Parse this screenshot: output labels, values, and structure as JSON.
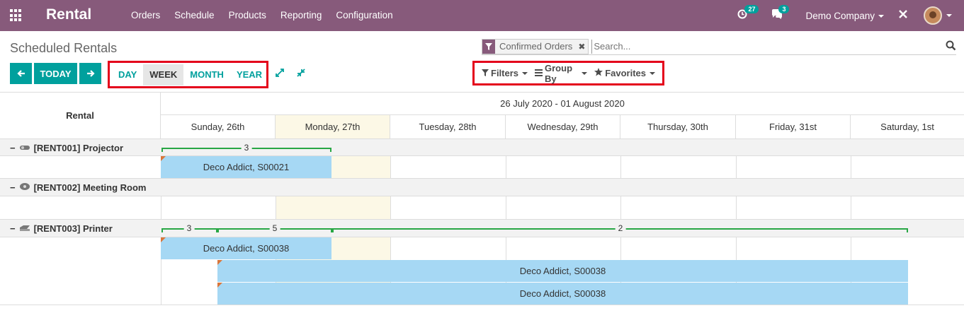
{
  "navbar": {
    "app_name": "Rental",
    "menu": [
      "Orders",
      "Schedule",
      "Products",
      "Reporting",
      "Configuration"
    ],
    "activity_count": "27",
    "messages_count": "3",
    "company": "Demo Company"
  },
  "control_panel": {
    "title": "Scheduled Rentals",
    "facet": "Confirmed Orders",
    "search_placeholder": "Search...",
    "today_label": "TODAY",
    "scales": [
      "DAY",
      "WEEK",
      "MONTH",
      "YEAR"
    ],
    "active_scale": "WEEK",
    "filters_label": "Filters",
    "group_by_label": "Group By",
    "favorites_label": "Favorites"
  },
  "gantt": {
    "row_header": "Rental",
    "range": "26 July 2020 - 01 August 2020",
    "days": [
      "Sunday, 26th",
      "Monday, 27th",
      "Tuesday, 28th",
      "Wednesday, 29th",
      "Thursday, 30th",
      "Friday, 31st",
      "Saturday, 1st"
    ],
    "groups": [
      {
        "label": "[RENT001] Projector",
        "aggregates": [
          "3"
        ],
        "pills": [
          "Deco Addict, S00021"
        ]
      },
      {
        "label": "[RENT002] Meeting Room",
        "aggregates": [],
        "pills": []
      },
      {
        "label": "[RENT003] Printer",
        "aggregates": [
          "3",
          "5",
          "2"
        ],
        "pills": [
          "Deco Addict, S00038",
          "Deco Addict, S00038",
          "Deco Addict, S00038"
        ]
      }
    ]
  },
  "colors": {
    "navbar": "#875a7b",
    "accent": "#00a09d",
    "pill": "#a6d8f4",
    "highlight": "#e4001b"
  }
}
